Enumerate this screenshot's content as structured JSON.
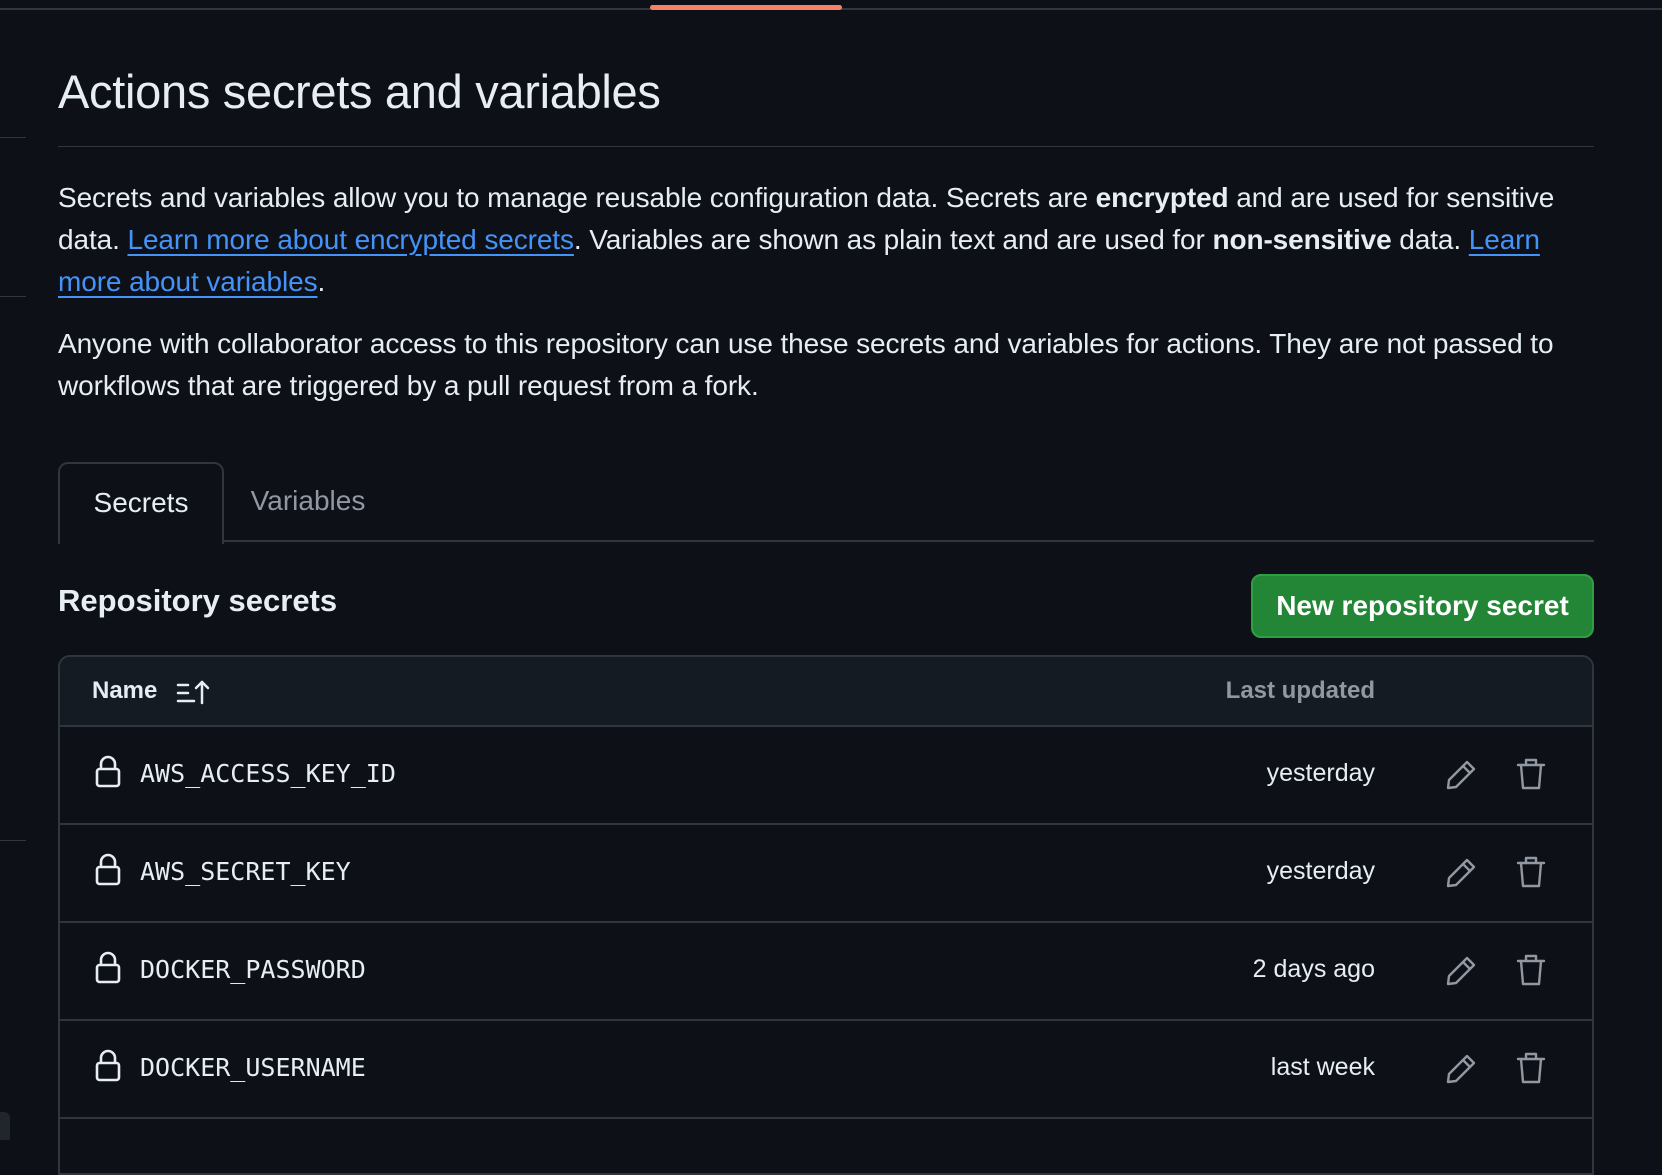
{
  "page": {
    "title": "Actions secrets and variables",
    "description": {
      "p1_a": "Secrets and variables allow you to manage reusable configuration data. Secrets are ",
      "p1_b": "encrypted",
      "p1_c": " and are used for sensitive data. ",
      "p1_link1": "Learn more about encrypted secrets",
      "p1_d": ". Variables are shown as plain text and are used for ",
      "p1_e": "non-sensitive",
      "p1_f": " data. ",
      "p1_link2": "Learn more about variables",
      "p1_g": ".",
      "p2": "Anyone with collaborator access to this repository can use these secrets and variables for actions. They are not passed to workflows that are triggered by a pull request from a fork."
    }
  },
  "tabs": [
    {
      "label": "Secrets",
      "active": true
    },
    {
      "label": "Variables",
      "active": false
    }
  ],
  "section": {
    "title": "Repository secrets",
    "new_button": "New repository secret"
  },
  "table": {
    "columns": {
      "name": "Name",
      "last_updated": "Last updated"
    },
    "rows": [
      {
        "name": "AWS_ACCESS_KEY_ID",
        "updated": "yesterday"
      },
      {
        "name": "AWS_SECRET_KEY",
        "updated": "yesterday"
      },
      {
        "name": "DOCKER_PASSWORD",
        "updated": "2 days ago"
      },
      {
        "name": "DOCKER_USERNAME",
        "updated": "last week"
      }
    ]
  },
  "icons": {
    "sort": "sort-ascending-icon",
    "lock": "lock-icon",
    "edit": "pencil-icon",
    "delete": "trash-icon"
  },
  "colors": {
    "background": "#0d1117",
    "link": "#4493f8",
    "primary_button": "#238636",
    "border": "#30363d",
    "tab_accent": "#f78166"
  }
}
